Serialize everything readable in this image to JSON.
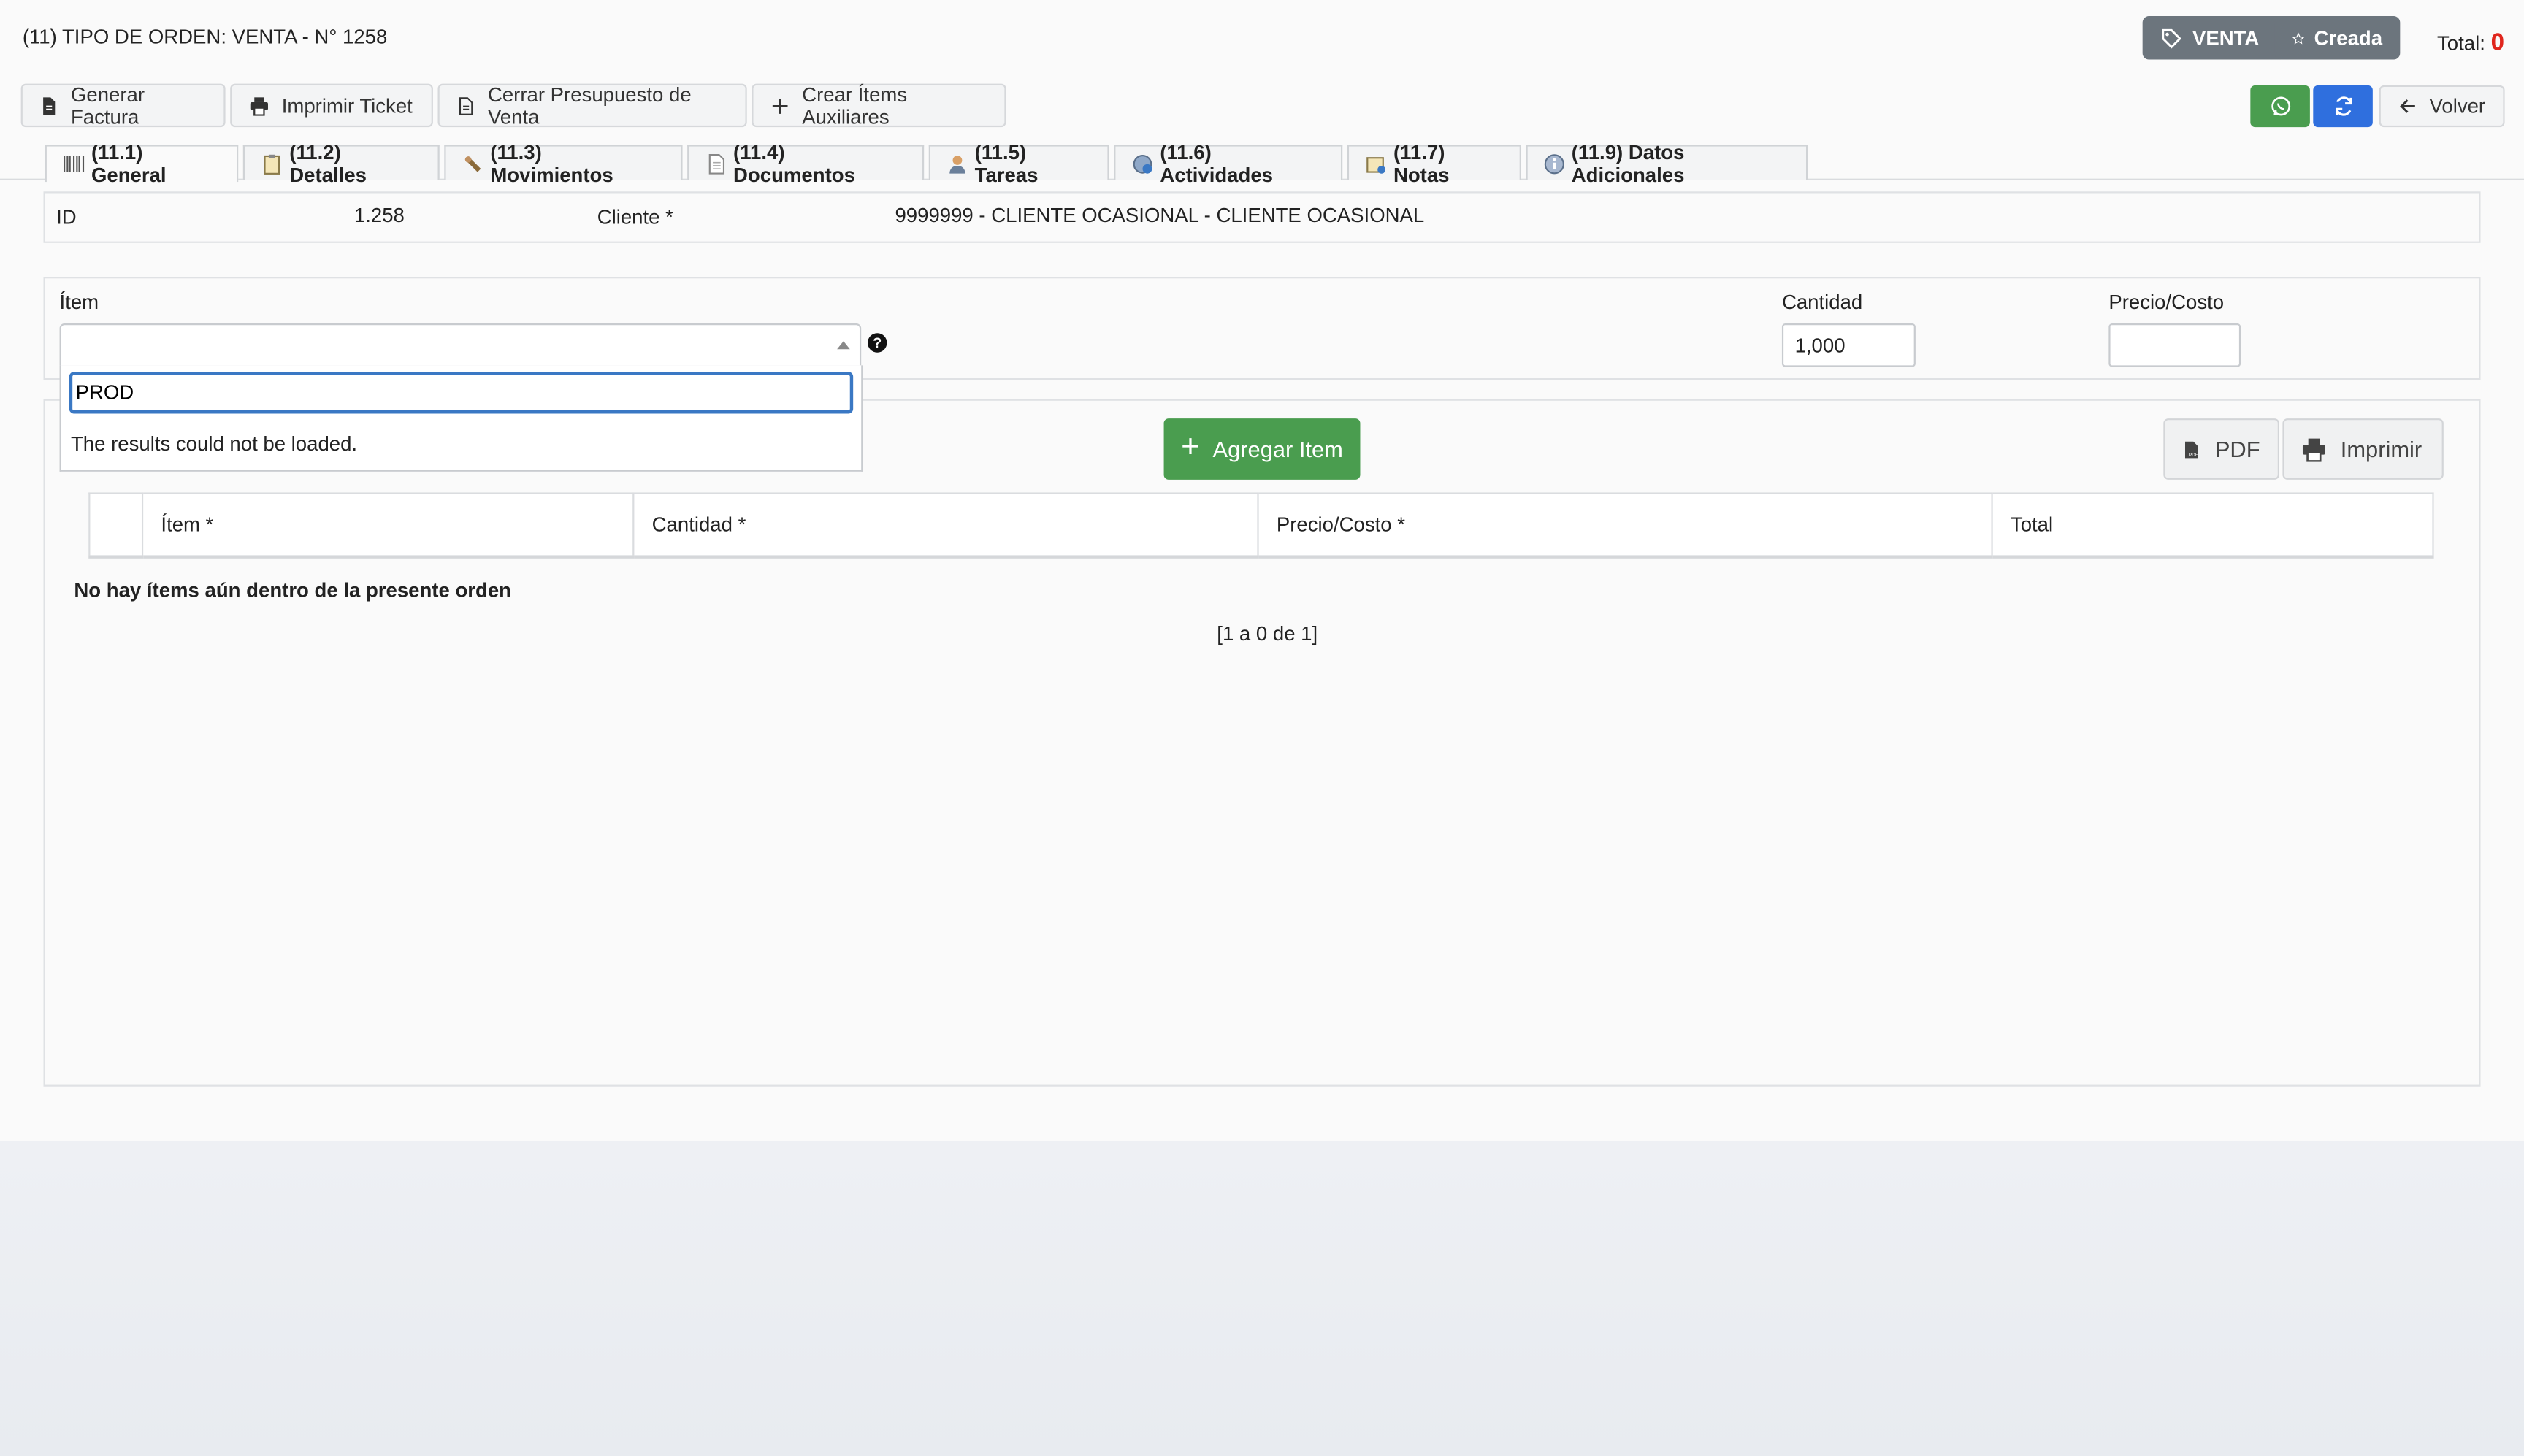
{
  "header": {
    "title": "(11) TIPO DE ORDEN: VENTA - N° 1258",
    "badge_type": "VENTA",
    "badge_status": "Creada",
    "total_label": "Total:",
    "total_value": "0"
  },
  "toolbar": {
    "generate_invoice": "Generar Factura",
    "print_ticket": "Imprimir Ticket",
    "close_budget": "Cerrar Presupuesto de Venta",
    "create_aux_items": "Crear Ítems Auxiliares",
    "back": "Volver"
  },
  "tabs": [
    {
      "label": "(11.1) General",
      "icon": "barcode-icon"
    },
    {
      "label": "(11.2) Detalles",
      "icon": "clipboard-icon"
    },
    {
      "label": "(11.3) Movimientos",
      "icon": "movements-icon"
    },
    {
      "label": "(11.4) Documentos",
      "icon": "document-icon"
    },
    {
      "label": "(11.5) Tareas",
      "icon": "user-icon"
    },
    {
      "label": "(11.6) Actividades",
      "icon": "activity-icon"
    },
    {
      "label": "(11.7) Notas",
      "icon": "notes-icon"
    },
    {
      "label": "(11.9) Datos Adicionales",
      "icon": "info-icon"
    }
  ],
  "general": {
    "id_label": "ID",
    "id_value": "1.258",
    "client_label": "Cliente *",
    "client_value": "9999999 - CLIENTE OCASIONAL - CLIENTE OCASIONAL"
  },
  "item_form": {
    "item_label": "Ítem",
    "search_value": "PROD",
    "results_message": "The results could not be loaded.",
    "help_symbol": "?",
    "quantity_label": "Cantidad",
    "quantity_value": "1,000",
    "price_label": "Precio/Costo",
    "price_value": ""
  },
  "actions": {
    "add_item": "Agregar Item",
    "pdf": "PDF",
    "print": "Imprimir"
  },
  "table": {
    "headers": [
      "",
      "Ítem *",
      "Cantidad *",
      "Precio/Costo *",
      "Total"
    ],
    "empty_message": "No hay ítems aún dentro de la presente orden",
    "pagination": "[1 a 0 de 1]"
  },
  "colors": {
    "green": "#4a9d4f",
    "blue": "#2f6fde",
    "badge_gray": "#6c757d",
    "total_red": "#e0261d",
    "focus_blue": "#3a78c4"
  }
}
